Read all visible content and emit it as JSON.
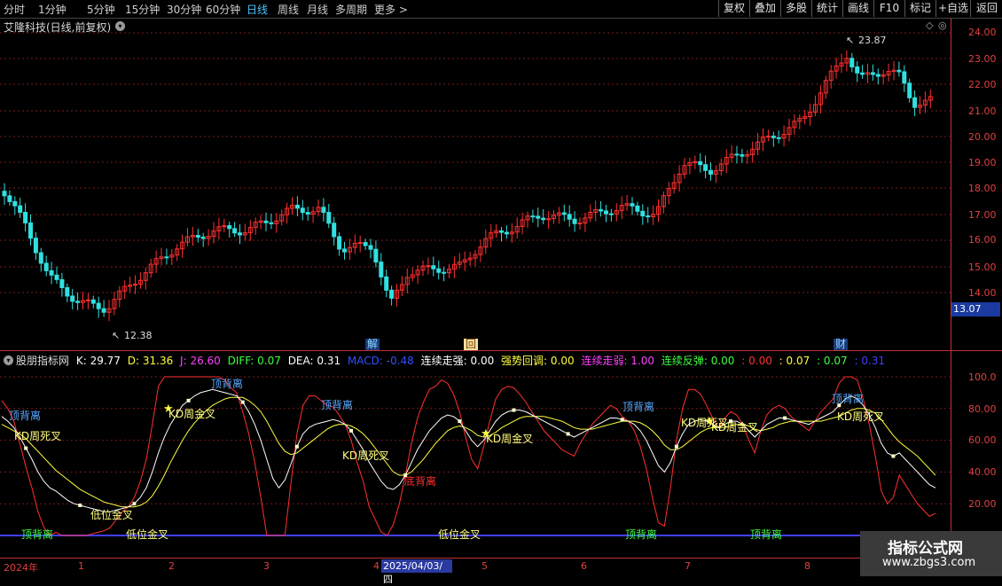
{
  "toolbar": {
    "periods": [
      "分时",
      "1分钟",
      "5分钟",
      "15分钟",
      "30分钟",
      "60分钟",
      "日线",
      "周线",
      "月线",
      "多周期",
      "更多 >"
    ],
    "active": "日线",
    "right_buttons": [
      "复权",
      "叠加",
      "多股",
      "统计",
      "画线",
      "F10",
      "标记",
      "+自选",
      "返回"
    ]
  },
  "main_chart": {
    "title": "艾隆科技(日线,前复权)",
    "y_ticks": [
      "24.00",
      "23.00",
      "22.00",
      "21.00",
      "20.00",
      "19.00",
      "18.00",
      "17.00",
      "16.00",
      "15.00",
      "14.00"
    ],
    "high_label": "23.87",
    "low_label": "12.38",
    "current_price": "13.07",
    "markers": [
      {
        "text": "解"
      },
      {
        "text": "回"
      },
      {
        "text": "财"
      }
    ]
  },
  "indicator": {
    "name": "股朋指标网",
    "values": [
      {
        "text": "K: 29.77",
        "color": "#ffffff"
      },
      {
        "text": "D: 31.36",
        "color": "#ffff40"
      },
      {
        "text": "J: 26.60",
        "color": "#ff40ff"
      },
      {
        "text": "DIFF: 0.07",
        "color": "#40ff40"
      },
      {
        "text": "DEA: 0.31",
        "color": "#ffffff"
      },
      {
        "text": "MACD: -0.48",
        "color": "#3050ff"
      },
      {
        "text": "连续走强: 0.00",
        "color": "#ffffff"
      },
      {
        "text": "强势回调: 0.00",
        "color": "#ffff40"
      },
      {
        "text": "连续走弱: 1.00",
        "color": "#ff40ff"
      },
      {
        "text": "连续反弹: 0.00",
        "color": "#40ff40"
      },
      {
        "text": ": 0.00",
        "color": "#ff3030"
      },
      {
        "text": ": 0.07",
        "color": "#ffff40"
      },
      {
        "text": ": 0.07",
        "color": "#40ff40"
      },
      {
        "text": ": 0.31",
        "color": "#4040ff"
      }
    ],
    "y_ticks": [
      "100.0",
      "80.00",
      "60.00",
      "40.00",
      "20.00"
    ],
    "labels": [
      {
        "text": "顶背离",
        "color": "#5aaaff"
      },
      {
        "text": "KD周死叉",
        "color": "#ffff80"
      },
      {
        "text": "低位金叉",
        "color": "#ffff80"
      },
      {
        "text": "顶背离",
        "color": "#40ff40"
      },
      {
        "text": "低位金叉",
        "color": "#ffff80"
      },
      {
        "text": "KD周金叉",
        "color": "#ffff80"
      },
      {
        "text": "顶背离",
        "color": "#5aaaff"
      },
      {
        "text": "顶背离",
        "color": "#5aaaff"
      },
      {
        "text": "KD周死叉",
        "color": "#ffff80"
      },
      {
        "text": "底背离",
        "color": "#ff3030"
      },
      {
        "text": "低位金叉",
        "color": "#ffff80"
      },
      {
        "text": "KD周金叉",
        "color": "#ffff80"
      },
      {
        "text": "顶背离",
        "color": "#5aaaff"
      },
      {
        "text": "顶背离",
        "color": "#40ff40"
      },
      {
        "text": "KD周死叉",
        "color": "#ffff80"
      },
      {
        "text": "KD周金叉",
        "color": "#ffff80"
      },
      {
        "text": "顶背离",
        "color": "#40ff40"
      },
      {
        "text": "顶背离",
        "color": "#5aaaff"
      },
      {
        "text": "KD周死叉",
        "color": "#ffff80"
      }
    ]
  },
  "x_axis": {
    "labels": [
      "2024年",
      "1",
      "2",
      "3",
      "4",
      "5",
      "6",
      "7",
      "8"
    ],
    "cursor_date": "2025/04/03/四"
  },
  "watermark": {
    "title": "指标公式网",
    "url": "www.zbgs3.com"
  },
  "chart_data": {
    "type": "candlestick",
    "price_range": [
      12.38,
      23.87
    ],
    "series": [
      {
        "name": "K",
        "color": "#ffffff",
        "values": [
          75,
          72,
          68,
          62,
          55,
          48,
          40,
          34,
          30,
          28,
          25,
          22,
          20,
          19,
          18,
          17,
          16,
          15,
          15,
          16,
          17,
          18,
          20,
          24,
          30,
          40,
          52,
          62,
          70,
          76,
          82,
          85,
          88,
          90,
          91,
          92,
          91,
          90,
          89,
          88,
          84,
          78,
          70,
          60,
          48,
          36,
          30,
          35,
          45,
          56,
          64,
          68,
          70,
          71,
          72,
          73,
          72,
          70,
          66,
          60,
          54,
          46,
          40,
          34,
          30,
          29,
          32,
          38,
          46,
          54,
          60,
          66,
          70,
          74,
          76,
          75,
          72,
          66,
          60,
          56,
          60,
          66,
          72,
          76,
          78,
          79,
          79,
          78,
          76,
          74,
          72,
          70,
          68,
          66,
          64,
          62,
          64,
          66,
          68,
          70,
          72,
          74,
          74,
          73,
          72,
          70,
          66,
          60,
          52,
          44,
          40,
          46,
          56,
          64,
          70,
          72,
          73,
          72,
          70,
          68,
          70,
          72,
          72,
          70,
          66,
          62,
          66,
          70,
          72,
          74,
          74,
          73,
          72,
          71,
          70,
          72,
          74,
          76,
          78,
          82,
          86,
          88,
          86,
          82,
          76,
          68,
          58,
          52,
          50,
          52,
          48,
          44,
          40,
          36,
          32,
          30
        ]
      },
      {
        "name": "D",
        "color": "#ffff40",
        "values": [
          70,
          68,
          66,
          64,
          61,
          57,
          53,
          49,
          45,
          41,
          38,
          35,
          32,
          29,
          27,
          25,
          23,
          21,
          20,
          19,
          18,
          18,
          18,
          19,
          21,
          25,
          31,
          38,
          46,
          53,
          60,
          66,
          71,
          75,
          79,
          82,
          84,
          86,
          87,
          87,
          87,
          85,
          82,
          78,
          72,
          65,
          58,
          53,
          51,
          52,
          55,
          58,
          61,
          64,
          67,
          69,
          70,
          70,
          69,
          67,
          64,
          60,
          55,
          50,
          45,
          40,
          38,
          38,
          40,
          44,
          48,
          53,
          58,
          62,
          66,
          68,
          69,
          68,
          66,
          63,
          62,
          63,
          65,
          68,
          70,
          72,
          74,
          75,
          75,
          75,
          75,
          74,
          73,
          72,
          70,
          68,
          67,
          67,
          67,
          68,
          69,
          70,
          71,
          72,
          72,
          72,
          71,
          69,
          66,
          62,
          57,
          54,
          54,
          56,
          59,
          62,
          65,
          67,
          68,
          68,
          68,
          69,
          70,
          70,
          69,
          67,
          66,
          67,
          68,
          70,
          71,
          72,
          72,
          72,
          72,
          72,
          72,
          73,
          74,
          75,
          77,
          79,
          80,
          80,
          79,
          77,
          73,
          68,
          63,
          59,
          56,
          53,
          50,
          46,
          42,
          38
        ]
      },
      {
        "name": "J",
        "color": "#ff3030",
        "values": [
          85,
          80,
          72,
          58,
          43,
          30,
          15,
          5,
          0,
          2,
          0,
          0,
          0,
          0,
          0,
          1,
          2,
          3,
          5,
          10,
          15,
          18,
          24,
          34,
          48,
          70,
          94,
          100,
          100,
          100,
          100,
          100,
          100,
          100,
          100,
          100,
          100,
          98,
          93,
          90,
          78,
          64,
          46,
          24,
          0,
          0,
          0,
          0,
          33,
          64,
          82,
          88,
          88,
          85,
          82,
          81,
          76,
          70,
          60,
          46,
          34,
          18,
          10,
          2,
          0,
          7,
          20,
          38,
          58,
          74,
          84,
          92,
          94,
          98,
          96,
          89,
          78,
          62,
          48,
          42,
          56,
          72,
          86,
          92,
          94,
          93,
          89,
          84,
          78,
          72,
          66,
          62,
          58,
          54,
          52,
          50,
          58,
          64,
          70,
          74,
          78,
          82,
          80,
          75,
          72,
          66,
          56,
          42,
          24,
          8,
          6,
          30,
          60,
          80,
          92,
          92,
          89,
          82,
          74,
          68,
          74,
          78,
          76,
          70,
          60,
          52,
          66,
          76,
          80,
          82,
          80,
          75,
          72,
          69,
          66,
          72,
          78,
          82,
          86,
          96,
          100,
          100,
          98,
          86,
          70,
          50,
          28,
          20,
          24,
          38,
          32,
          26,
          20,
          16,
          12,
          14
        ]
      }
    ]
  }
}
